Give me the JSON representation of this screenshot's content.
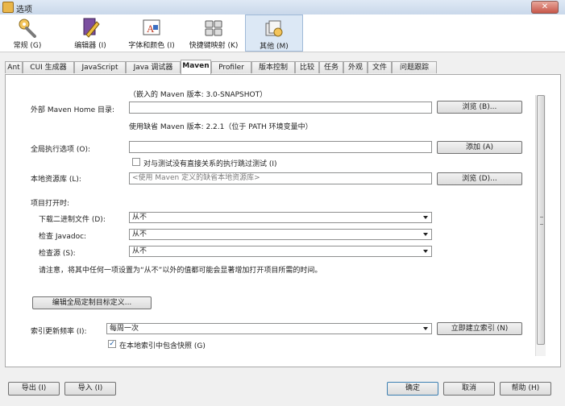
{
  "window": {
    "title": "选项",
    "close_label": "✕"
  },
  "categories": [
    {
      "label": "常规 (G)",
      "icon": "wrench-gear-icon"
    },
    {
      "label": "编辑器 (I)",
      "icon": "pencil-book-icon"
    },
    {
      "label": "字体和颜色 (I)",
      "icon": "font-color-icon"
    },
    {
      "label": "快捷键映射 (K)",
      "icon": "keyboard-icon"
    },
    {
      "label": "其他 (M)",
      "icon": "misc-folder-icon",
      "selected": true
    }
  ],
  "tabs": [
    "Ant",
    "CUI 生成器",
    "JavaScript",
    "Java 调试器",
    "Maven",
    "Profiler",
    "版本控制",
    "比较",
    "任务",
    "外观",
    "文件",
    "问题跟踪"
  ],
  "selected_tab": "Maven",
  "maven": {
    "embedded_version": "（嵌入的 Maven 版本: 3.0-SNAPSHOT）",
    "home_label": "外部 Maven Home 目录:",
    "home_value": "",
    "browse_label": "浏览 (B)...",
    "default_version": "使用缺省 Maven 版本: 2.2.1（位于 PATH 环境变量中）",
    "global_opts_label": "全局执行选项 (O):",
    "global_opts_value": "",
    "add_label": "添加 (A)",
    "skip_tests_label": "对与测试没有直接关系的执行跳过测试 (I)",
    "skip_tests_checked": false,
    "local_repo_label": "本地资源库 (L):",
    "local_repo_placeholder": "<使用 Maven 定义的缺省本地资源库>",
    "browse2_label": "浏览 (D)...",
    "on_open_label": "项目打开时:",
    "download_binaries_label": "下载二进制文件 (D):",
    "download_binaries_value": "从不",
    "check_javadoc_label": "检查 Javadoc:",
    "check_javadoc_value": "从不",
    "check_sources_label": "检查源 (S):",
    "check_sources_value": "从不",
    "note": "请注意，将其中任何一项设置为“从不”以外的值都可能会显著增加打开项目所需的时间。",
    "edit_global_label": "编辑全局定制目标定义...",
    "index_freq_label": "索引更新频率 (I):",
    "index_freq_value": "每周一次",
    "index_now_label": "立即建立索引 (N)",
    "include_snapshots_label": "在本地索引中包含快照 (G)",
    "include_snapshots_checked": true
  },
  "footer": {
    "export_label": "导出 (I)",
    "import_label": "导入 (I)",
    "ok_label": "确定",
    "cancel_label": "取消",
    "help_label": "帮助 (H)"
  }
}
